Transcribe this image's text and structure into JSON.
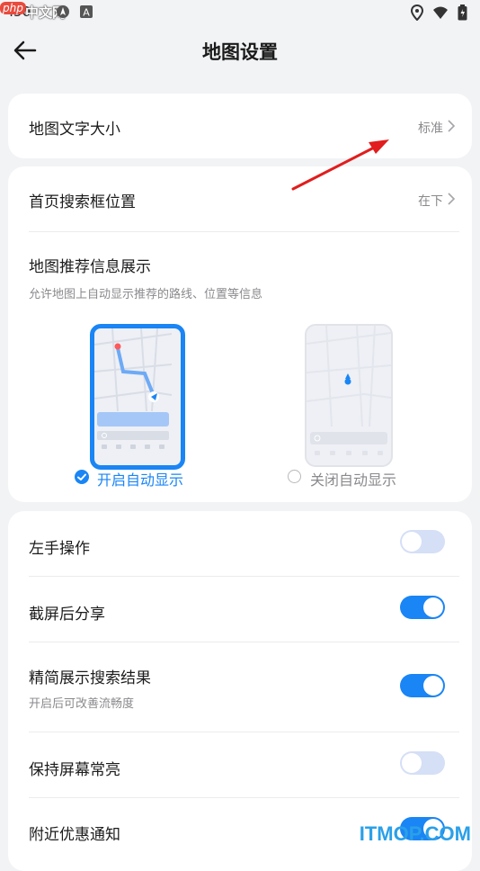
{
  "status_bar": {
    "time": ":50",
    "watermark_php": "php",
    "watermark_cn": "中文网",
    "icons": [
      "sync-icon",
      "nav-icon",
      "app-a-icon",
      "location-icon",
      "wifi-icon",
      "battery-icon"
    ]
  },
  "header": {
    "title": "地图设置",
    "back_icon": "arrow-left-icon"
  },
  "text_size": {
    "label": "地图文字大小",
    "value": "标准"
  },
  "search_box": {
    "label": "首页搜索框位置",
    "value": "在下"
  },
  "recommend": {
    "title": "地图推荐信息展示",
    "description": "允许地图上自动显示推荐的路线、位置等信息",
    "options": [
      {
        "label": "开启自动显示",
        "selected": true
      },
      {
        "label": "关闭自动显示",
        "selected": false
      }
    ]
  },
  "toggles": [
    {
      "label": "左手操作",
      "subtitle": "",
      "on": false
    },
    {
      "label": "截屏后分享",
      "subtitle": "",
      "on": true
    },
    {
      "label": "精简展示搜索结果",
      "subtitle": "开启后可改善流畅度",
      "on": true
    },
    {
      "label": "保持屏幕常亮",
      "subtitle": "",
      "on": false
    },
    {
      "label": "附近优惠通知",
      "subtitle": "",
      "on": true
    }
  ],
  "colors": {
    "accent": "#1a85f5",
    "toggle_off": "#d5dff6",
    "annotation_arrow": "#e11d1d"
  },
  "watermark": "ITMOP.COM"
}
